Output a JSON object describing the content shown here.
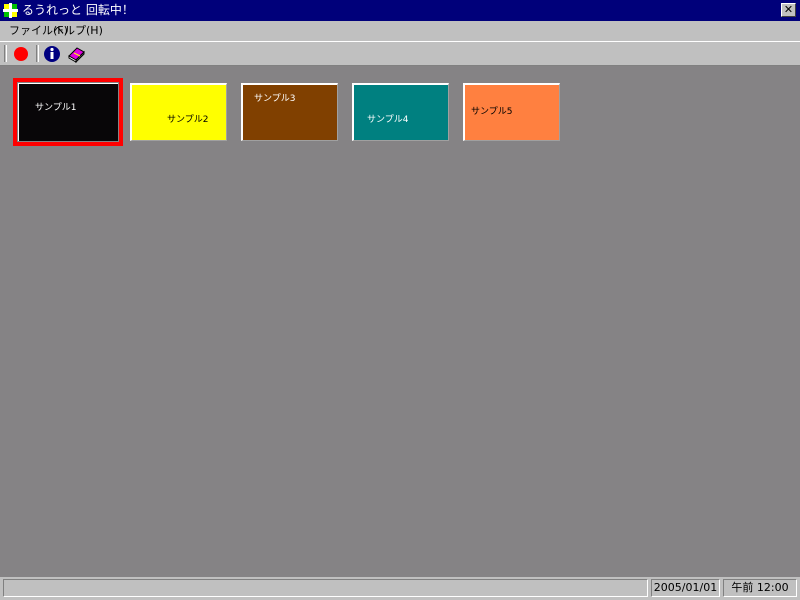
{
  "window": {
    "title": "るうれっと 回転中！",
    "close_glyph": "✕"
  },
  "menu": [
    {
      "label": "ファイル(F)"
    },
    {
      "label": "ヘルプ(H)"
    }
  ],
  "toolbar": {
    "buttons": [
      {
        "icon": "record-icon"
      },
      {
        "icon": "info-icon"
      },
      {
        "icon": "book-icon"
      }
    ]
  },
  "tiles": [
    {
      "label": "サンプル1",
      "color": "#080608",
      "text_color": "#ffffff",
      "selected": true
    },
    {
      "label": "サンプル2",
      "color": "#ffff00",
      "text_color": "#000000",
      "selected": false
    },
    {
      "label": "サンプル3",
      "color": "#804000",
      "text_color": "#ffffff",
      "selected": false
    },
    {
      "label": "サンプル4",
      "color": "#008080",
      "text_color": "#ffffff",
      "selected": false
    },
    {
      "label": "サンプル5",
      "color": "#ff8040",
      "text_color": "#000000",
      "selected": false
    }
  ],
  "colors": {
    "selection": "#ff0000",
    "titlebar": "#00007a",
    "workspace": "#858385"
  },
  "status": {
    "message": "",
    "date": "2005/01/01",
    "time": "午前 12:00"
  }
}
